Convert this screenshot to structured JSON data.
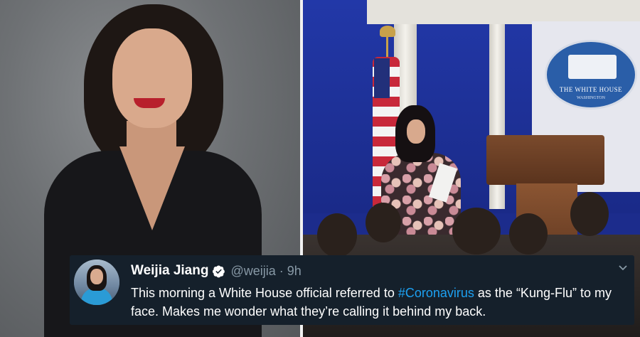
{
  "tweet": {
    "name": "Weijia Jiang",
    "handle": "@weijia",
    "separator": "·",
    "time": "9h",
    "text_before": "This morning a White House official referred to ",
    "hashtag": "#Coronavirus",
    "text_after": " as the “Kung-Flu” to my face. Makes me wonder what they’re calling it behind my back."
  },
  "scene": {
    "seal_text": "THE WHITE HOUSE",
    "seal_subtext": "WASHINGTON"
  },
  "colors": {
    "card_background": "#15202b",
    "hashtag": "#1da1f2",
    "verified_badge": "#ffffff",
    "secondary_text": "#8899a6"
  },
  "icons": {
    "verified": "verified-badge-icon",
    "menu": "chevron-down-icon"
  }
}
